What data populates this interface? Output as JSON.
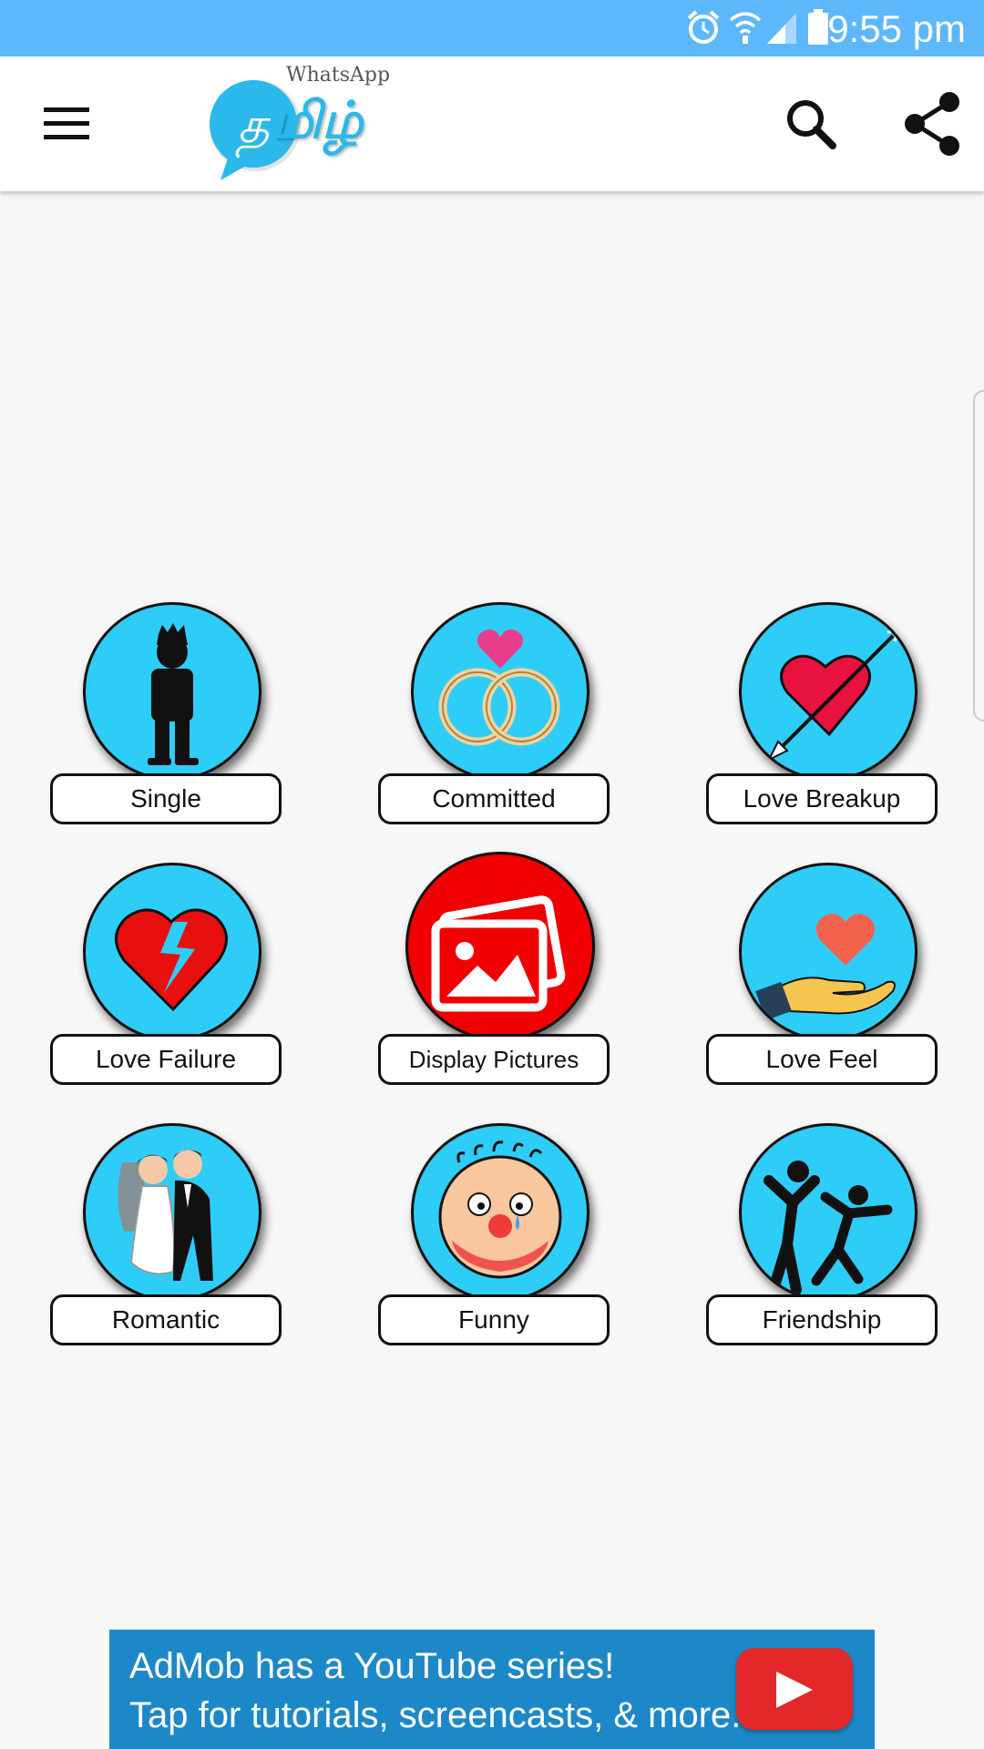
{
  "status_bar": {
    "time": "9:55 pm",
    "icons": [
      "alarm-icon",
      "wifi-icon",
      "signal-icon",
      "battery-icon"
    ]
  },
  "app_bar": {
    "logo_sub": "WhatsApp",
    "logo_main": "மிழ்",
    "logo_glyph": "த",
    "icons": [
      "menu-icon",
      "search-icon",
      "share-icon"
    ]
  },
  "categories": [
    {
      "label": "Single",
      "icon": "standing-man-icon"
    },
    {
      "label": "Committed",
      "icon": "wedding-rings-icon"
    },
    {
      "label": "Love Breakup",
      "icon": "heart-arrow-icon"
    },
    {
      "label": "Love Failure",
      "icon": "broken-heart-icon"
    },
    {
      "label": "Display Pictures",
      "icon": "photos-icon"
    },
    {
      "label": "Love Feel",
      "icon": "heart-in-hand-icon"
    },
    {
      "label": "Romantic",
      "icon": "bride-groom-icon"
    },
    {
      "label": "Funny",
      "icon": "clown-face-icon"
    },
    {
      "label": "Friendship",
      "icon": "dancing-friends-icon"
    }
  ],
  "ad": {
    "line1": "AdMob has a YouTube series!",
    "line2": "Tap for tutorials, screencasts, & more."
  },
  "colors": {
    "status_bar": "#5db7fb",
    "tile_circle": "#2ecdf8",
    "display_pictures_circle": "#f00000",
    "ad_background": "#1d88c7"
  }
}
